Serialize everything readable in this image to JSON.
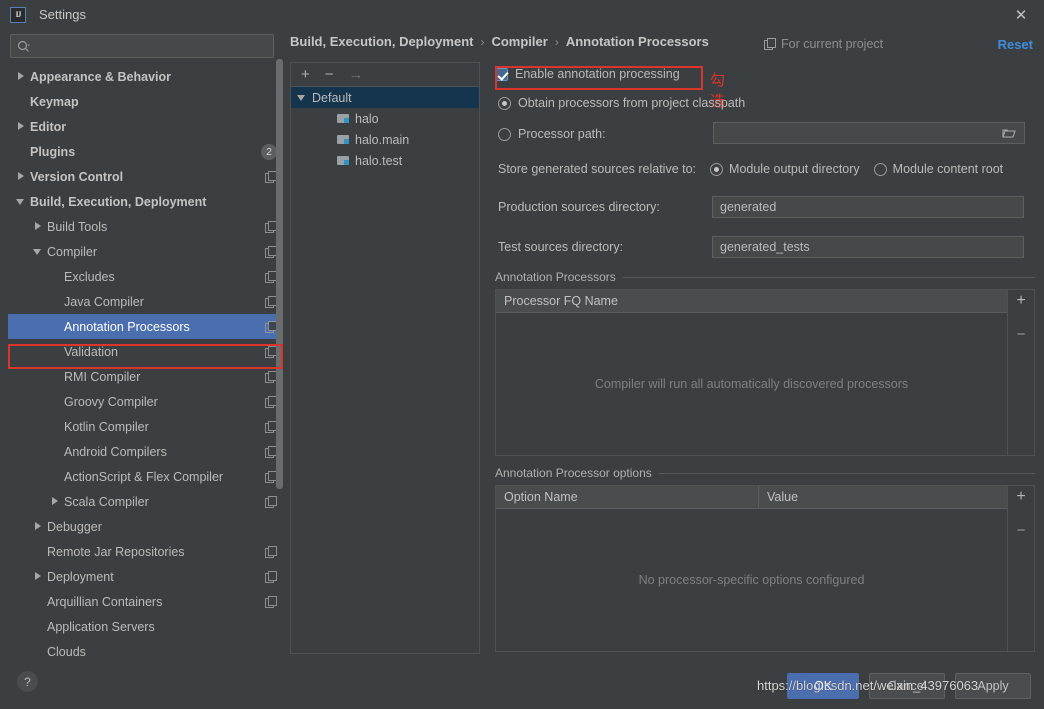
{
  "window": {
    "title": "Settings",
    "logo_text": "IJ",
    "close_icon": "✕"
  },
  "sidebar": {
    "search_placeholder": "",
    "search_value": "",
    "items": [
      {
        "label": "Appearance & Behavior",
        "indent": 0,
        "arrow": "right",
        "bold": true,
        "copy": false,
        "badge": ""
      },
      {
        "label": "Keymap",
        "indent": 0,
        "arrow": "none",
        "bold": true,
        "copy": false,
        "badge": ""
      },
      {
        "label": "Editor",
        "indent": 0,
        "arrow": "right",
        "bold": true,
        "copy": false,
        "badge": ""
      },
      {
        "label": "Plugins",
        "indent": 0,
        "arrow": "none",
        "bold": true,
        "copy": false,
        "badge": "2"
      },
      {
        "label": "Version Control",
        "indent": 0,
        "arrow": "right",
        "bold": true,
        "copy": true,
        "badge": ""
      },
      {
        "label": "Build, Execution, Deployment",
        "indent": 0,
        "arrow": "down",
        "bold": true,
        "copy": false,
        "badge": ""
      },
      {
        "label": "Build Tools",
        "indent": 1,
        "arrow": "right",
        "bold": false,
        "copy": true,
        "badge": ""
      },
      {
        "label": "Compiler",
        "indent": 1,
        "arrow": "down",
        "bold": false,
        "copy": true,
        "badge": ""
      },
      {
        "label": "Excludes",
        "indent": 2,
        "arrow": "none",
        "bold": false,
        "copy": true,
        "badge": ""
      },
      {
        "label": "Java Compiler",
        "indent": 2,
        "arrow": "none",
        "bold": false,
        "copy": true,
        "badge": ""
      },
      {
        "label": "Annotation Processors",
        "indent": 2,
        "arrow": "none",
        "bold": false,
        "copy": true,
        "badge": "",
        "selected": true
      },
      {
        "label": "Validation",
        "indent": 2,
        "arrow": "none",
        "bold": false,
        "copy": true,
        "badge": ""
      },
      {
        "label": "RMI Compiler",
        "indent": 2,
        "arrow": "none",
        "bold": false,
        "copy": true,
        "badge": ""
      },
      {
        "label": "Groovy Compiler",
        "indent": 2,
        "arrow": "none",
        "bold": false,
        "copy": true,
        "badge": ""
      },
      {
        "label": "Kotlin Compiler",
        "indent": 2,
        "arrow": "none",
        "bold": false,
        "copy": true,
        "badge": ""
      },
      {
        "label": "Android Compilers",
        "indent": 2,
        "arrow": "none",
        "bold": false,
        "copy": true,
        "badge": ""
      },
      {
        "label": "ActionScript & Flex Compiler",
        "indent": 2,
        "arrow": "none",
        "bold": false,
        "copy": true,
        "badge": ""
      },
      {
        "label": "Scala Compiler",
        "indent": 2,
        "arrow": "right",
        "bold": false,
        "copy": true,
        "badge": ""
      },
      {
        "label": "Debugger",
        "indent": 1,
        "arrow": "right",
        "bold": false,
        "copy": false,
        "badge": ""
      },
      {
        "label": "Remote Jar Repositories",
        "indent": 1,
        "arrow": "none",
        "bold": false,
        "copy": true,
        "badge": ""
      },
      {
        "label": "Deployment",
        "indent": 1,
        "arrow": "right",
        "bold": false,
        "copy": true,
        "badge": ""
      },
      {
        "label": "Arquillian Containers",
        "indent": 1,
        "arrow": "none",
        "bold": false,
        "copy": true,
        "badge": ""
      },
      {
        "label": "Application Servers",
        "indent": 1,
        "arrow": "none",
        "bold": false,
        "copy": false,
        "badge": ""
      },
      {
        "label": "Clouds",
        "indent": 1,
        "arrow": "none",
        "bold": false,
        "copy": false,
        "badge": ""
      }
    ]
  },
  "header": {
    "breadcrumb": [
      "Build, Execution, Deployment",
      "Compiler",
      "Annotation Processors"
    ],
    "separator": "›",
    "for_project_label": "For current project",
    "reset_label": "Reset"
  },
  "modules": {
    "toolbar": {
      "add": "+",
      "remove": "−",
      "move": "→"
    },
    "root": "Default",
    "items": [
      "halo",
      "halo.main",
      "halo.test"
    ]
  },
  "settings": {
    "enable_annotation_processing": "Enable annotation processing",
    "annotation_note_cn": "勾选",
    "obtain_from_classpath": "Obtain processors from project classpath",
    "processor_path_label": "Processor path:",
    "processor_path_value": "",
    "store_generated_label": "Store generated sources relative to:",
    "module_output_directory": "Module output directory",
    "module_content_root": "Module content root",
    "production_sources_label": "Production sources directory:",
    "production_sources_value": "generated",
    "test_sources_label": "Test sources directory:",
    "test_sources_value": "generated_tests",
    "processors_group_title": "Annotation Processors",
    "processors_column": "Processor FQ Name",
    "processors_empty": "Compiler will run all automatically discovered processors",
    "options_group_title": "Annotation Processor options",
    "options_column_name": "Option Name",
    "options_column_value": "Value",
    "options_empty": "No processor-specific options configured",
    "add_icon": "+",
    "remove_icon": "−"
  },
  "footer": {
    "help": "?",
    "ok": "OK",
    "cancel": "Cancel",
    "apply": "Apply",
    "watermark": "https://blog.csdn.net/weixin_43976063"
  },
  "colors": {
    "accent_blue": "#4b6eaf",
    "link_blue": "#3f8cdd",
    "annotation_red": "#d9352c",
    "panel_bg": "#3c3f41",
    "input_bg": "#45494a"
  }
}
